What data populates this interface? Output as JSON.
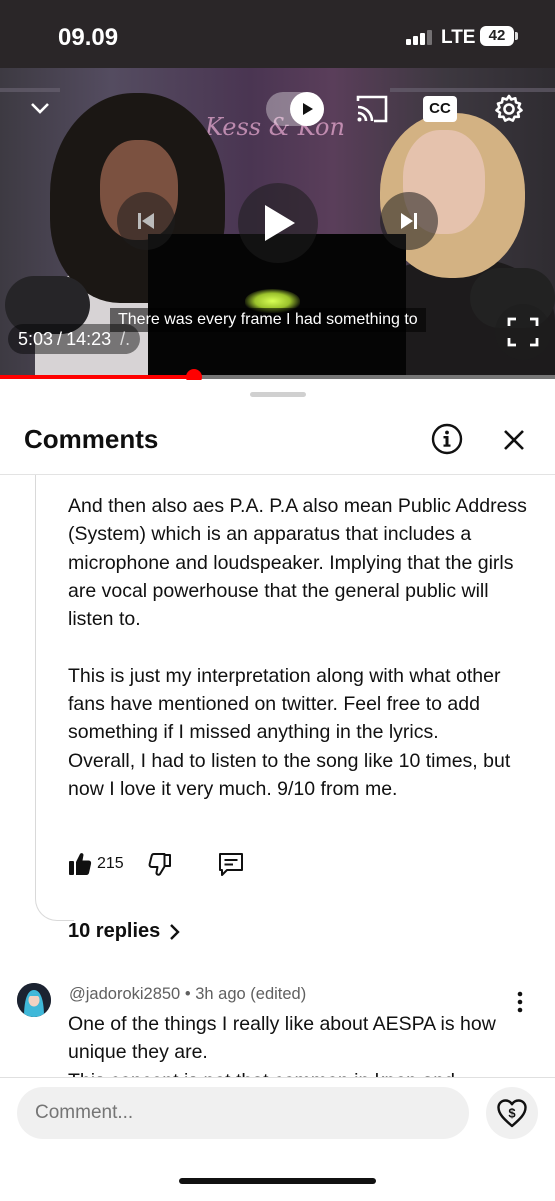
{
  "status_bar": {
    "time": "09.09",
    "network": "LTE",
    "battery": "42"
  },
  "video": {
    "subtitle": "There was every frame I had something to",
    "current_time": "5:03",
    "separator": "/",
    "duration": "14:23",
    "progress_fraction": 0.35,
    "background_sign": "Kess & Kon",
    "overlay_fragment": "/."
  },
  "comments_sheet": {
    "title": "Comments",
    "comment": {
      "paragraphs": [
        "And then also aes P.A. P.A also mean Public Address (System) which is an apparatus that includes a microphone and loudspeaker. Implying that the girls are vocal powerhouse that the general public will listen to.",
        "",
        "This is just my interpretation along with what other fans have mentioned on twitter. Feel free to add something if I missed anything in the lyrics.",
        "Overall, I had to listen to the song like 10 times, but now I love it very much. 9/10 from me."
      ],
      "likes": "215",
      "replies_label": "10 replies"
    },
    "next_comment": {
      "author": "@jadoroki2850",
      "dot": "•",
      "time": "3h ago (edited)",
      "text": "One of the things I really like about AESPA is how unique they are.",
      "cut_text": "This concept is not that common in kpop and"
    },
    "composer": {
      "placeholder": "Comment..."
    }
  },
  "colors": {
    "accent": "#ff0000",
    "text": "#0f0f0f",
    "muted": "#606060"
  },
  "icons": [
    "chevron-down-icon",
    "autoplay-toggle-icon",
    "cast-icon",
    "cc-icon",
    "settings-gear-icon",
    "previous-icon",
    "play-icon",
    "next-icon",
    "fullscreen-icon",
    "info-icon",
    "close-icon",
    "thumbs-up-icon",
    "thumbs-down-icon",
    "reply-icon",
    "chevron-right-icon",
    "more-vert-icon",
    "super-thanks-icon"
  ]
}
